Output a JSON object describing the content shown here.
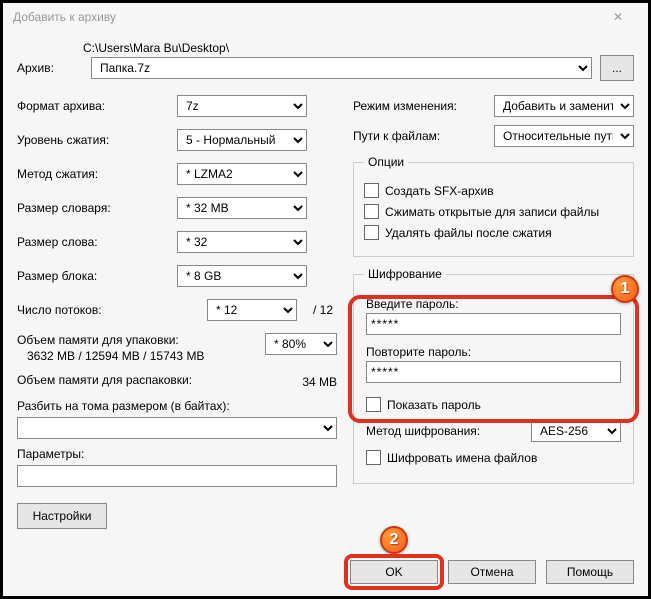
{
  "title": "Добавить к архиву",
  "archive_label": "Архив:",
  "archive_path": "C:\\Users\\Mara Bu\\Desktop\\",
  "archive_name": "Папка.7z",
  "browse": "...",
  "left": {
    "format_label": "Формат архива:",
    "format_value": "7z",
    "level_label": "Уровень сжатия:",
    "level_value": "5 - Нормальный",
    "method_label": "Метод сжатия:",
    "method_value": "* LZMA2",
    "dict_label": "Размер словаря:",
    "dict_value": "* 32 MB",
    "word_label": "Размер слова:",
    "word_value": "* 32",
    "block_label": "Размер блока:",
    "block_value": "* 8 GB",
    "threads_label": "Число потоков:",
    "threads_value": "* 12",
    "threads_max": "/ 12",
    "mem_pack_label": "Объем памяти для упаковки:",
    "mem_pack_vals": "3632 MB / 12594 MB / 15743 MB",
    "mem_pack_pct": "* 80%",
    "mem_unpack_label": "Объем памяти для распаковки:",
    "mem_unpack_val": "34 MB",
    "split_label": "Разбить на тома размером (в байтах):",
    "split_value": "",
    "params_label": "Параметры:",
    "params_value": "",
    "settings_btn": "Настройки"
  },
  "right": {
    "mode_label": "Режим изменения:",
    "mode_value": "Добавить и заменить",
    "paths_label": "Пути к файлам:",
    "paths_value": "Относительные пути",
    "options_legend": "Опции",
    "opt_sfx": "Создать SFX-архив",
    "opt_open": "Сжимать открытые для записи файлы",
    "opt_delete": "Удалять файлы после сжатия",
    "enc_legend": "Шифрование",
    "pw1_label": "Введите пароль:",
    "pw1_value": "*****",
    "pw2_label": "Повторите пароль:",
    "pw2_value": "*****",
    "show_pw": "Показать пароль",
    "enc_method_label": "Метод шифрования:",
    "enc_method_value": "AES-256",
    "enc_names": "Шифровать имена файлов"
  },
  "buttons": {
    "ok": "OK",
    "cancel": "Отмена",
    "help": "Помощь"
  },
  "badges": {
    "one": "1",
    "two": "2"
  }
}
